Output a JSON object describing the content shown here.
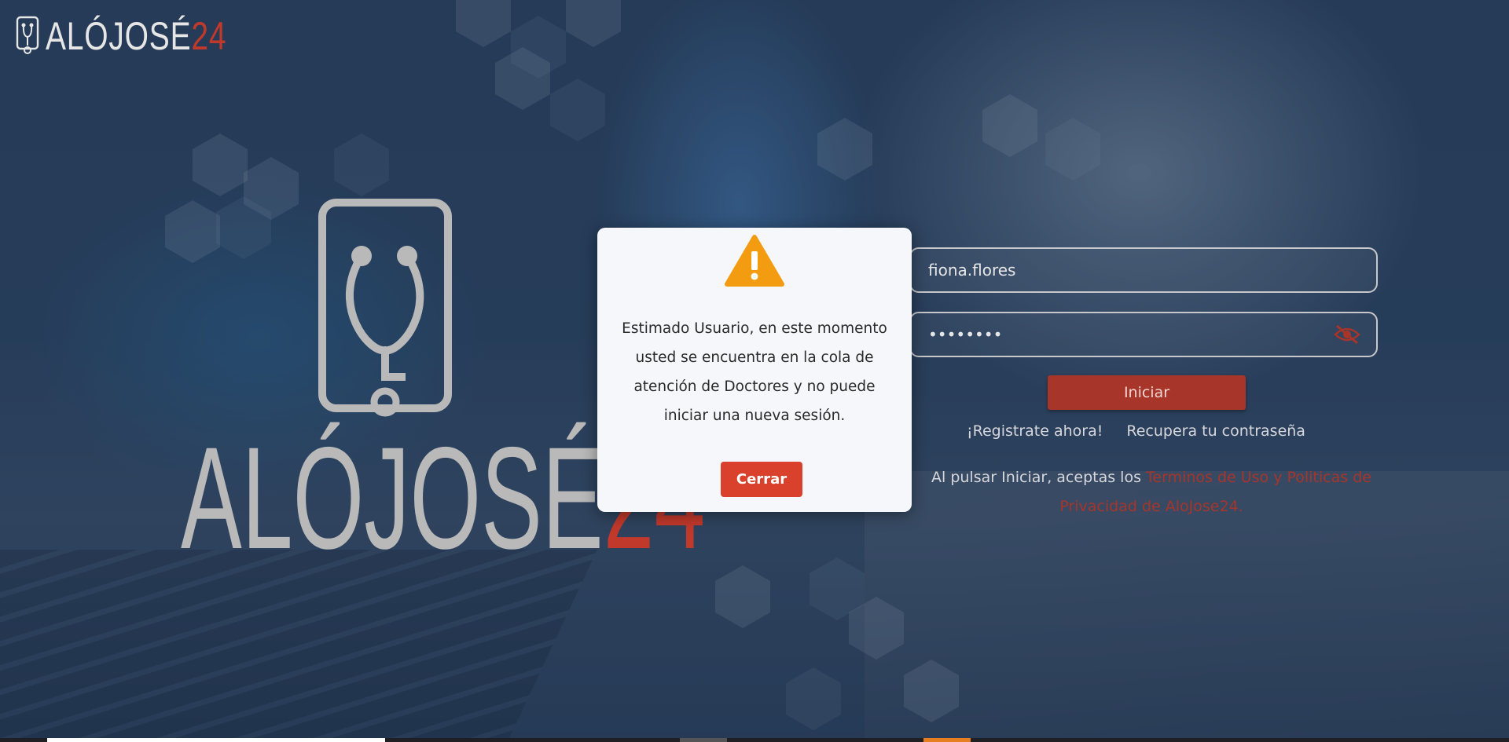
{
  "brand": {
    "logo_word": "ALÓJOSÉ",
    "logo_number": "24",
    "accent_color": "#c0392b"
  },
  "login": {
    "username_value": "fiona.flores",
    "password_value": "********",
    "submit_label": "Iniciar",
    "register_link": "¡Registrate ahora!",
    "recover_link": "Recupera tu contraseña",
    "terms_prefix": "Al pulsar Iniciar, aceptas los ",
    "terms_link": "Terminos de Uso y Politicas de Privacidad de AloJose24."
  },
  "modal": {
    "icon": "warning-icon",
    "message": "Estimado Usuario, en este momento usted se encuentra en la cola de atención de Doctores y no puede iniciar una nueva sesión.",
    "close_label": "Cerrar",
    "icon_color": "#f39c12",
    "button_color": "#d9412c"
  }
}
